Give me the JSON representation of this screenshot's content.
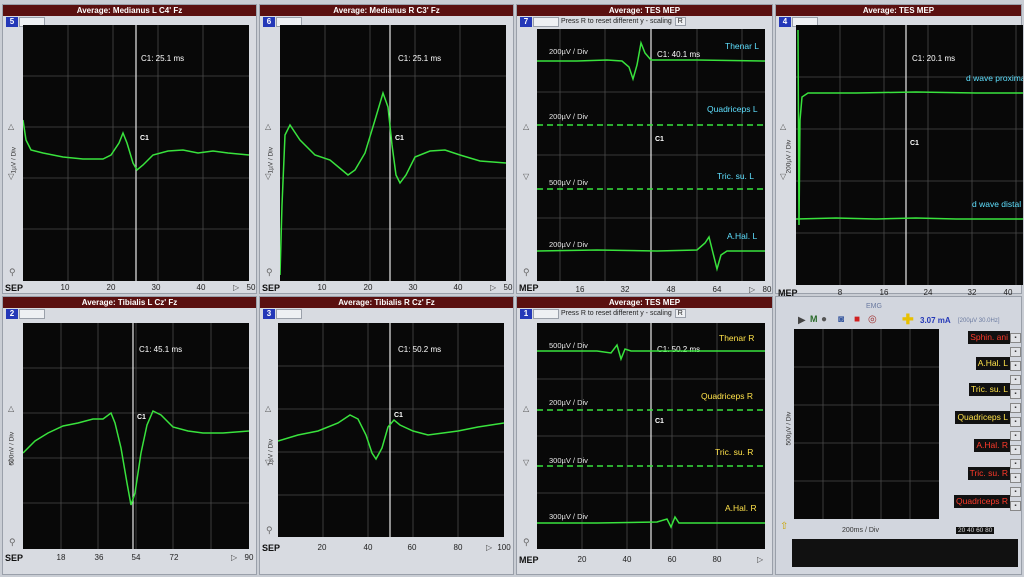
{
  "panels": {
    "p5": {
      "title": "Average: Medianus L C4' Fz",
      "num": "5",
      "mode": "SEP",
      "ylabel": "1µV / Div",
      "cursor": "C1:   25.1 ms",
      "cmark": "C1",
      "xticks": [
        "10",
        "20",
        "30",
        "40",
        "50"
      ]
    },
    "p6": {
      "title": "Average: Medianus R C3' Fz",
      "num": "6",
      "mode": "SEP",
      "ylabel": "1µV / Div",
      "cursor": "C1:   25.1 ms",
      "cmark": "C1",
      "xticks": [
        "10",
        "20",
        "30",
        "40",
        "50"
      ]
    },
    "p7": {
      "title": "Average: TES MEP",
      "num": "7",
      "mode": "MEP",
      "hint": "Press R to reset different y - scaling",
      "hint_key": "R",
      "cursor": "C1:   40.1 ms",
      "cmark": "C1",
      "xticks": [
        "16",
        "32",
        "48",
        "64",
        "80"
      ],
      "channels": [
        {
          "name": "Thenar L",
          "div": "200µV / Div"
        },
        {
          "name": "Quadriceps L",
          "div": "200µV / Div"
        },
        {
          "name": "Tric. su. L",
          "div": "500µV / Div"
        },
        {
          "name": "A.Hal. L",
          "div": "200µV / Div"
        }
      ]
    },
    "p4": {
      "title": "Average: TES MEP",
      "num": "4",
      "mode": "MEP",
      "ylabel": "200µV / Div",
      "cursor": "C1:   20.1 ms",
      "cmark": "C1",
      "xticks": [
        "8",
        "16",
        "24",
        "32",
        "40"
      ],
      "labels": [
        "d wave proximal",
        "d wave distal"
      ]
    },
    "p2": {
      "title": "Average: Tibialis L Cz' Fz",
      "num": "2",
      "mode": "SEP",
      "ylabel": "500nV / Div",
      "cursor": "C1:   45.1 ms",
      "cmark": "C1",
      "xticks": [
        "18",
        "36",
        "54",
        "72",
        "90"
      ]
    },
    "p3": {
      "title": "Average: Tibialis R Cz' Fz",
      "num": "3",
      "mode": "SEP",
      "ylabel": "1µV / Div",
      "cursor": "C1:   50.2 ms",
      "cmark": "C1",
      "xticks": [
        "20",
        "40",
        "60",
        "80",
        "100"
      ]
    },
    "p1": {
      "title": "Average: TES MEP",
      "num": "1",
      "mode": "MEP",
      "hint": "Press R to reset different y - scaling",
      "hint_key": "R",
      "cursor": "C1:   50.2 ms",
      "cmark": "C1",
      "xticks": [
        "20",
        "40",
        "60",
        "80"
      ],
      "channels": [
        {
          "name": "Thenar R",
          "div": "500µV / Div"
        },
        {
          "name": "Quadriceps R",
          "div": "200µV / Div"
        },
        {
          "name": "Tric. su. R",
          "div": "300µV / Div"
        },
        {
          "name": "A.Hal. R",
          "div": "300µV / Div"
        }
      ]
    },
    "emg": {
      "title": "EMG",
      "current": "3.07 mA",
      "range": "[200µV  30.0Hz]",
      "ylabel": "500µV / Div",
      "xlabel": "200ms / Div",
      "xticks": "20 40 60 80",
      "channels": [
        {
          "name": "Sphin. ani",
          "color": "#ff3a2a"
        },
        {
          "name": "A.Hal. L",
          "color": "#ffe24a"
        },
        {
          "name": "Tric. su. L",
          "color": "#ffe24a"
        },
        {
          "name": "Quadriceps L",
          "color": "#ffe24a"
        },
        {
          "name": "A.Hal. R",
          "color": "#ff3a2a"
        },
        {
          "name": "Tric. su. R",
          "color": "#ff3a2a"
        },
        {
          "name": "Quadriceps R",
          "color": "#ff3a2a"
        }
      ]
    }
  },
  "colors": {
    "trace": "#39e23d",
    "cyan": "#5fe0ff",
    "yellow": "#ffe24a",
    "red": "#ff3a2a",
    "titlebar": "#5a1010"
  }
}
